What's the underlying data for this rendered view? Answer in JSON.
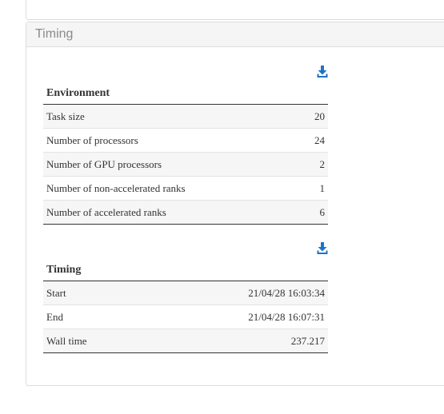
{
  "panel": {
    "title": "Timing"
  },
  "environment": {
    "title": "Environment",
    "rows": [
      {
        "label": "Task size",
        "value": "20"
      },
      {
        "label": "Number of processors",
        "value": "24"
      },
      {
        "label": "Number of GPU processors",
        "value": "2"
      },
      {
        "label": "Number of non-accelerated ranks",
        "value": "1"
      },
      {
        "label": "Number of accelerated ranks",
        "value": "6"
      }
    ]
  },
  "timing": {
    "title": "Timing",
    "rows": [
      {
        "label": "Start",
        "value": "21/04/28 16:03:34"
      },
      {
        "label": "End",
        "value": "21/04/28 16:07:31"
      },
      {
        "label": "Wall time",
        "value": "237.217"
      }
    ]
  },
  "icons": {
    "download": "download-icon",
    "accent": "#1f73c4"
  }
}
